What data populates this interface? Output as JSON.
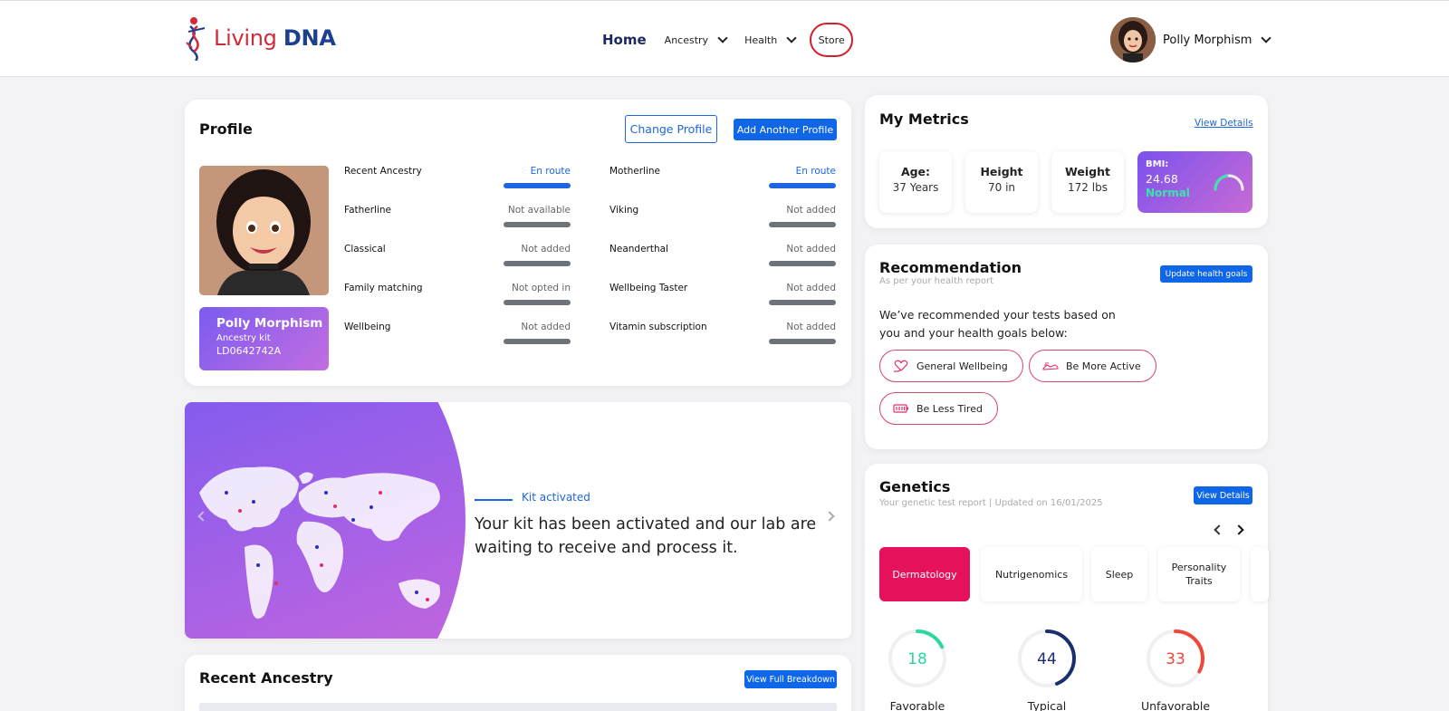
{
  "header": {
    "brand_living": "Living",
    "brand_dna": "DNA",
    "nav": {
      "home": "Home",
      "ancestry": "Ancestry",
      "health": "Health",
      "store": "Store"
    },
    "user_name": "Polly Morphism"
  },
  "profile": {
    "title": "Profile",
    "change_profile": "Change Profile",
    "add_profile": "Add Another Profile",
    "badge": {
      "name": "Polly Morphism",
      "kit": "Ancestry kit",
      "id": "LD0642742A"
    },
    "left_items": [
      {
        "label": "Recent Ancestry",
        "status": "En route"
      },
      {
        "label": "Fatherline",
        "status": "Not available"
      },
      {
        "label": "Classical",
        "status": "Not added"
      },
      {
        "label": "Family matching",
        "status": "Not opted in"
      },
      {
        "label": "Wellbeing",
        "status": "Not added"
      }
    ],
    "right_items": [
      {
        "label": "Motherline",
        "status": "En route"
      },
      {
        "label": "Viking",
        "status": "Not added"
      },
      {
        "label": "Neanderthal",
        "status": "Not added"
      },
      {
        "label": "Wellbeing Taster",
        "status": "Not added"
      },
      {
        "label": "Vitamin subscription",
        "status": "Not added"
      }
    ]
  },
  "banner": {
    "tag": "Kit activated",
    "text": "Your kit has been activated and our lab are waiting to receive and process it."
  },
  "recent_ancestry": {
    "title": "Recent Ancestry",
    "button": "View Full Breakdown"
  },
  "metrics": {
    "title": "My Metrics",
    "view_details": "View Details",
    "age_label": "Age:",
    "age_value": "37 Years",
    "height_label": "Height",
    "height_value": "70 in",
    "weight_label": "Weight",
    "weight_value": "172 lbs",
    "bmi_label": "BMI:",
    "bmi_value": "24.68",
    "bmi_status": "Normal"
  },
  "recommendation": {
    "title": "Recommendation",
    "subtitle": "As per your health report",
    "button": "Update health goals",
    "text": "We’ve recommended your tests based on you and your health goals below:",
    "pills": [
      "General Wellbeing",
      "Be More Active",
      "Be Less Tired"
    ]
  },
  "genetics": {
    "title": "Genetics",
    "subtitle": "Your genetic test report | Updated on 16/01/2025",
    "button": "View Details",
    "tabs": [
      "Dermatology",
      "Nutrigenomics",
      "Sleep",
      "Personality Traits"
    ],
    "active_tab": "Dermatology",
    "scores": [
      {
        "value": "18",
        "label": "Favorable",
        "color": "#2ed6a0",
        "fraction": 0.18
      },
      {
        "value": "44",
        "label": "Typical",
        "color": "#1b2f6e",
        "fraction": 0.44
      },
      {
        "value": "33",
        "label": "Unfavorable",
        "color": "#f0473b",
        "fraction": 0.33
      }
    ]
  },
  "colors": {
    "accent_blue": "#0f66e8",
    "pink": "#e5115d",
    "purple_start": "#7b5cf0",
    "purple_end": "#c86ad6"
  }
}
